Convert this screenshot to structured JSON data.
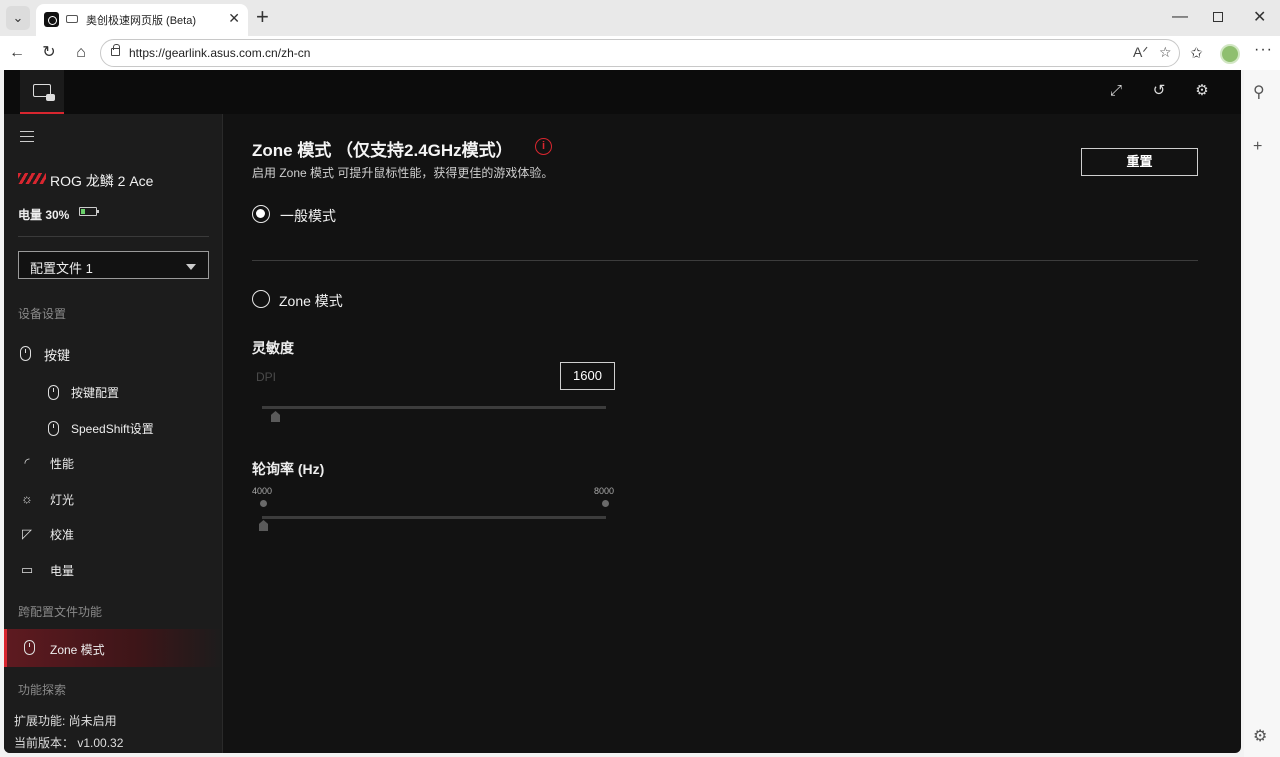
{
  "browser": {
    "tab_title": "奥创极速网页版 (Beta)",
    "url": "https://gearlink.asus.com.cn/zh-cn"
  },
  "sidebar": {
    "device_name": "ROG 龙鳞 2 Ace",
    "battery": "电量 30%",
    "battery_level": 0.3,
    "profile": "配置文件 1",
    "section_device": "设备设置",
    "items": [
      {
        "label": "按键",
        "icon": "mouse-icon"
      },
      {
        "label": "按键配置",
        "icon": "mouse-icon"
      },
      {
        "label": "SpeedShift设置",
        "icon": "mouse-icon"
      },
      {
        "label": "性能",
        "icon": "gauge-icon"
      },
      {
        "label": "灯光",
        "icon": "light-icon"
      },
      {
        "label": "校准",
        "icon": "calibrate-icon"
      },
      {
        "label": "电量",
        "icon": "battery-icon"
      }
    ],
    "section_cross": "跨配置文件功能",
    "zone_item": "Zone 模式",
    "section_explore": "功能探索",
    "extensions": "扩展功能: 尚未启用",
    "version": "当前版本： v1.00.32"
  },
  "main": {
    "title": "Zone 模式 （仅支持2.4GHz模式）",
    "subtitle": "启用 Zone 模式 可提升鼠标性能，获得更佳的游戏体验。",
    "reset_label": "重置",
    "option_normal": "一般模式",
    "option_zone": "Zone 模式",
    "selected_option": "一般模式",
    "sensitivity_label": "灵敏度",
    "dpi_label": "DPI",
    "dpi_value": "1600",
    "polling_label": "轮询率 (Hz)",
    "polling_min": "4000",
    "polling_max": "8000",
    "polling_value": 4000
  },
  "colors": {
    "accent": "#d8262f",
    "background": "#121212",
    "sidebar": "#1c1c1c"
  }
}
